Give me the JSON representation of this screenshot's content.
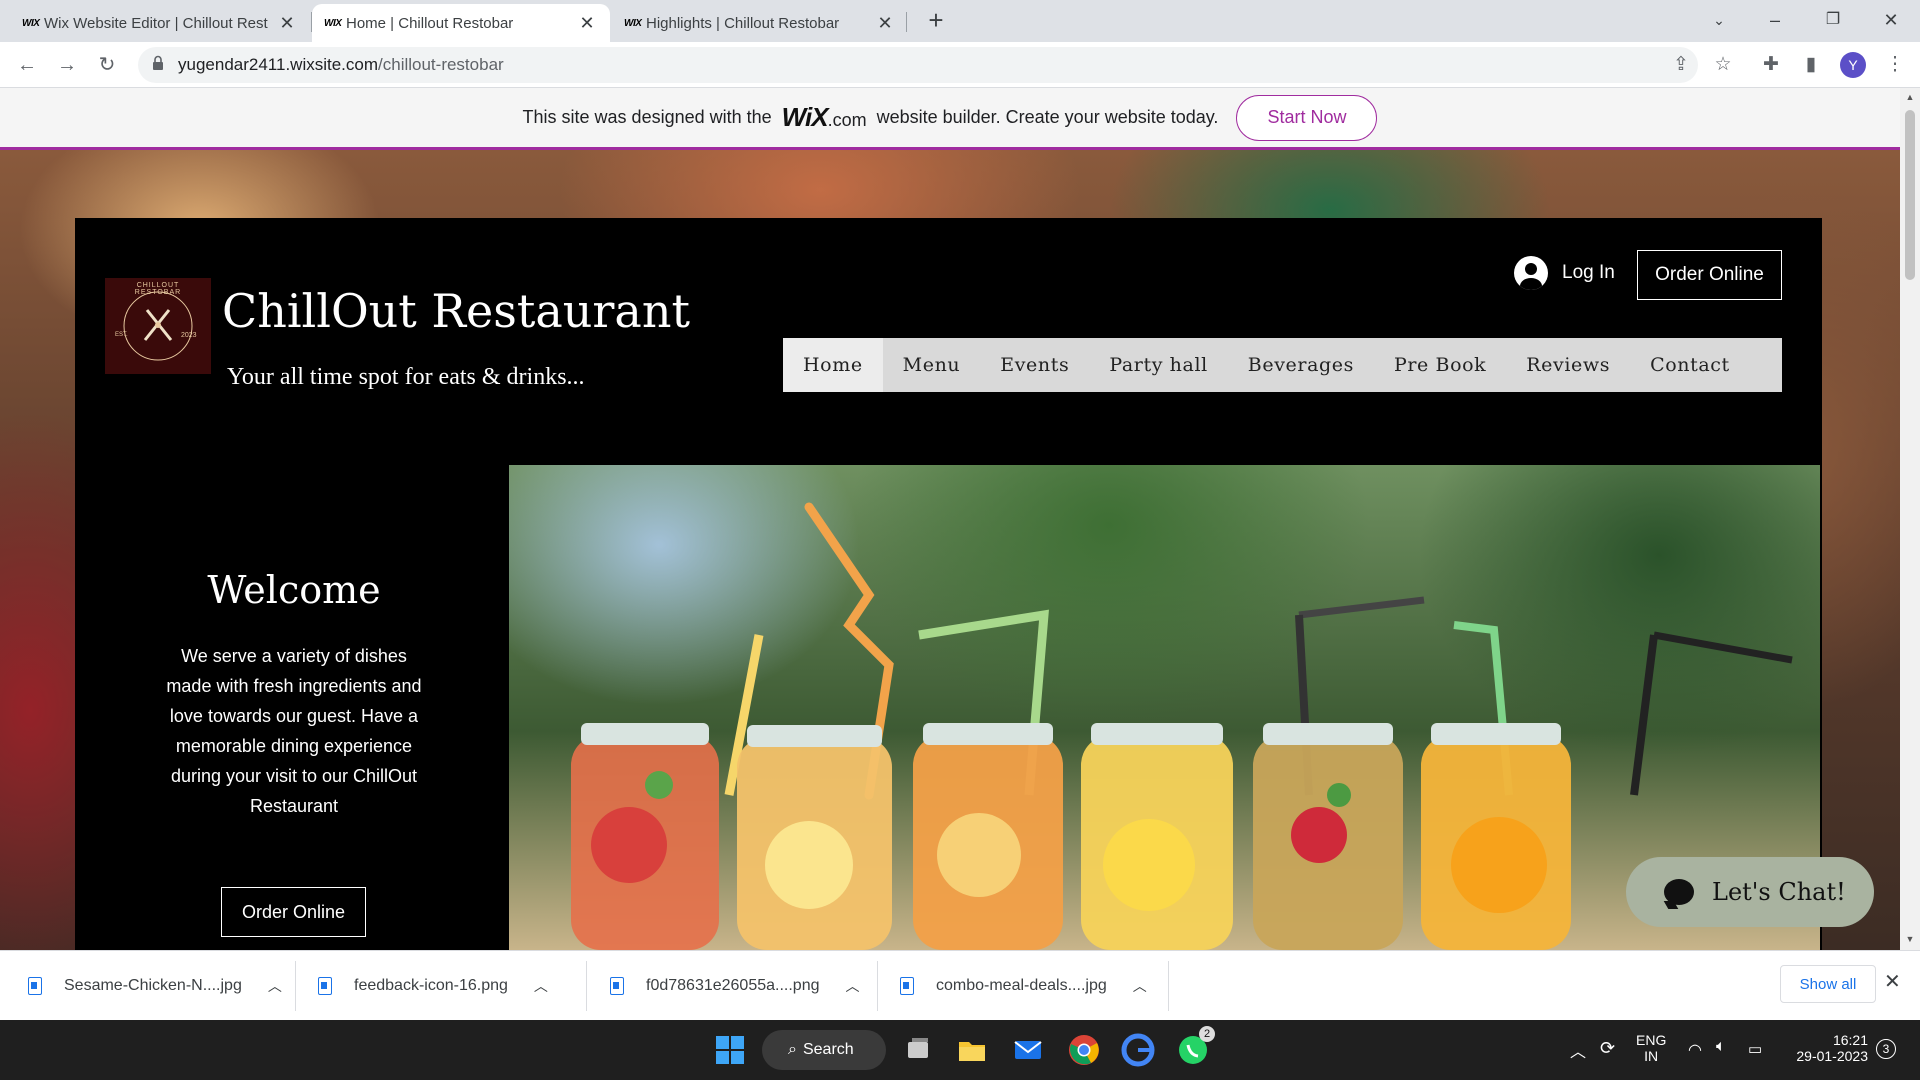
{
  "browser": {
    "tabs": [
      {
        "favicon": "WIX",
        "title": "Wix Website Editor | Chillout Rest"
      },
      {
        "favicon": "WIX",
        "title": "Home | Chillout Restobar"
      },
      {
        "favicon": "WIX",
        "title": "Highlights | Chillout Restobar"
      }
    ],
    "url_domain": "yugendar2411.wixsite.com",
    "url_path": "/chillout-restobar",
    "profile_initial": "Y"
  },
  "wix_banner": {
    "text_before": "This site was designed with the",
    "logo": "WiX",
    "dotcom": ".com",
    "text_after": "website builder. Create your website today.",
    "button": "Start Now"
  },
  "site": {
    "title": "ChillOut Restaurant",
    "tagline": "Your all time spot for eats & drinks...",
    "logo_text_top": "CHILLOUT RESTOBAR",
    "logo_est": "EST.",
    "logo_year": "2023",
    "login": "Log In",
    "order_online_top": "Order Online",
    "menu": [
      "Home",
      "Menu",
      "Events",
      "Party hall",
      "Beverages",
      "Pre Book",
      "Reviews",
      "Contact"
    ],
    "welcome_title": "Welcome",
    "welcome_text": "We serve a variety of dishes made with fresh ingredients and love towards our guest. Have a memorable dining experience during your visit to our ChillOut Restaurant",
    "order_online_main": "Order Online",
    "chat": "Let's Chat!"
  },
  "downloads": {
    "items": [
      "Sesame-Chicken-N....jpg",
      "feedback-icon-16.png",
      "f0d78631e26055a....png",
      "combo-meal-deals....jpg"
    ],
    "show_all": "Show all"
  },
  "taskbar": {
    "search": "Search",
    "lang": "ENG",
    "region": "IN",
    "time": "16:21",
    "date": "29-01-2023",
    "notif_count": "3",
    "whatsapp_badge": "2"
  },
  "colors": {
    "wix_accent": "#a02c9f",
    "page_black": "#000000",
    "menu_bg": "#d9d9d9",
    "chat_bg": "#a9b3a0"
  }
}
